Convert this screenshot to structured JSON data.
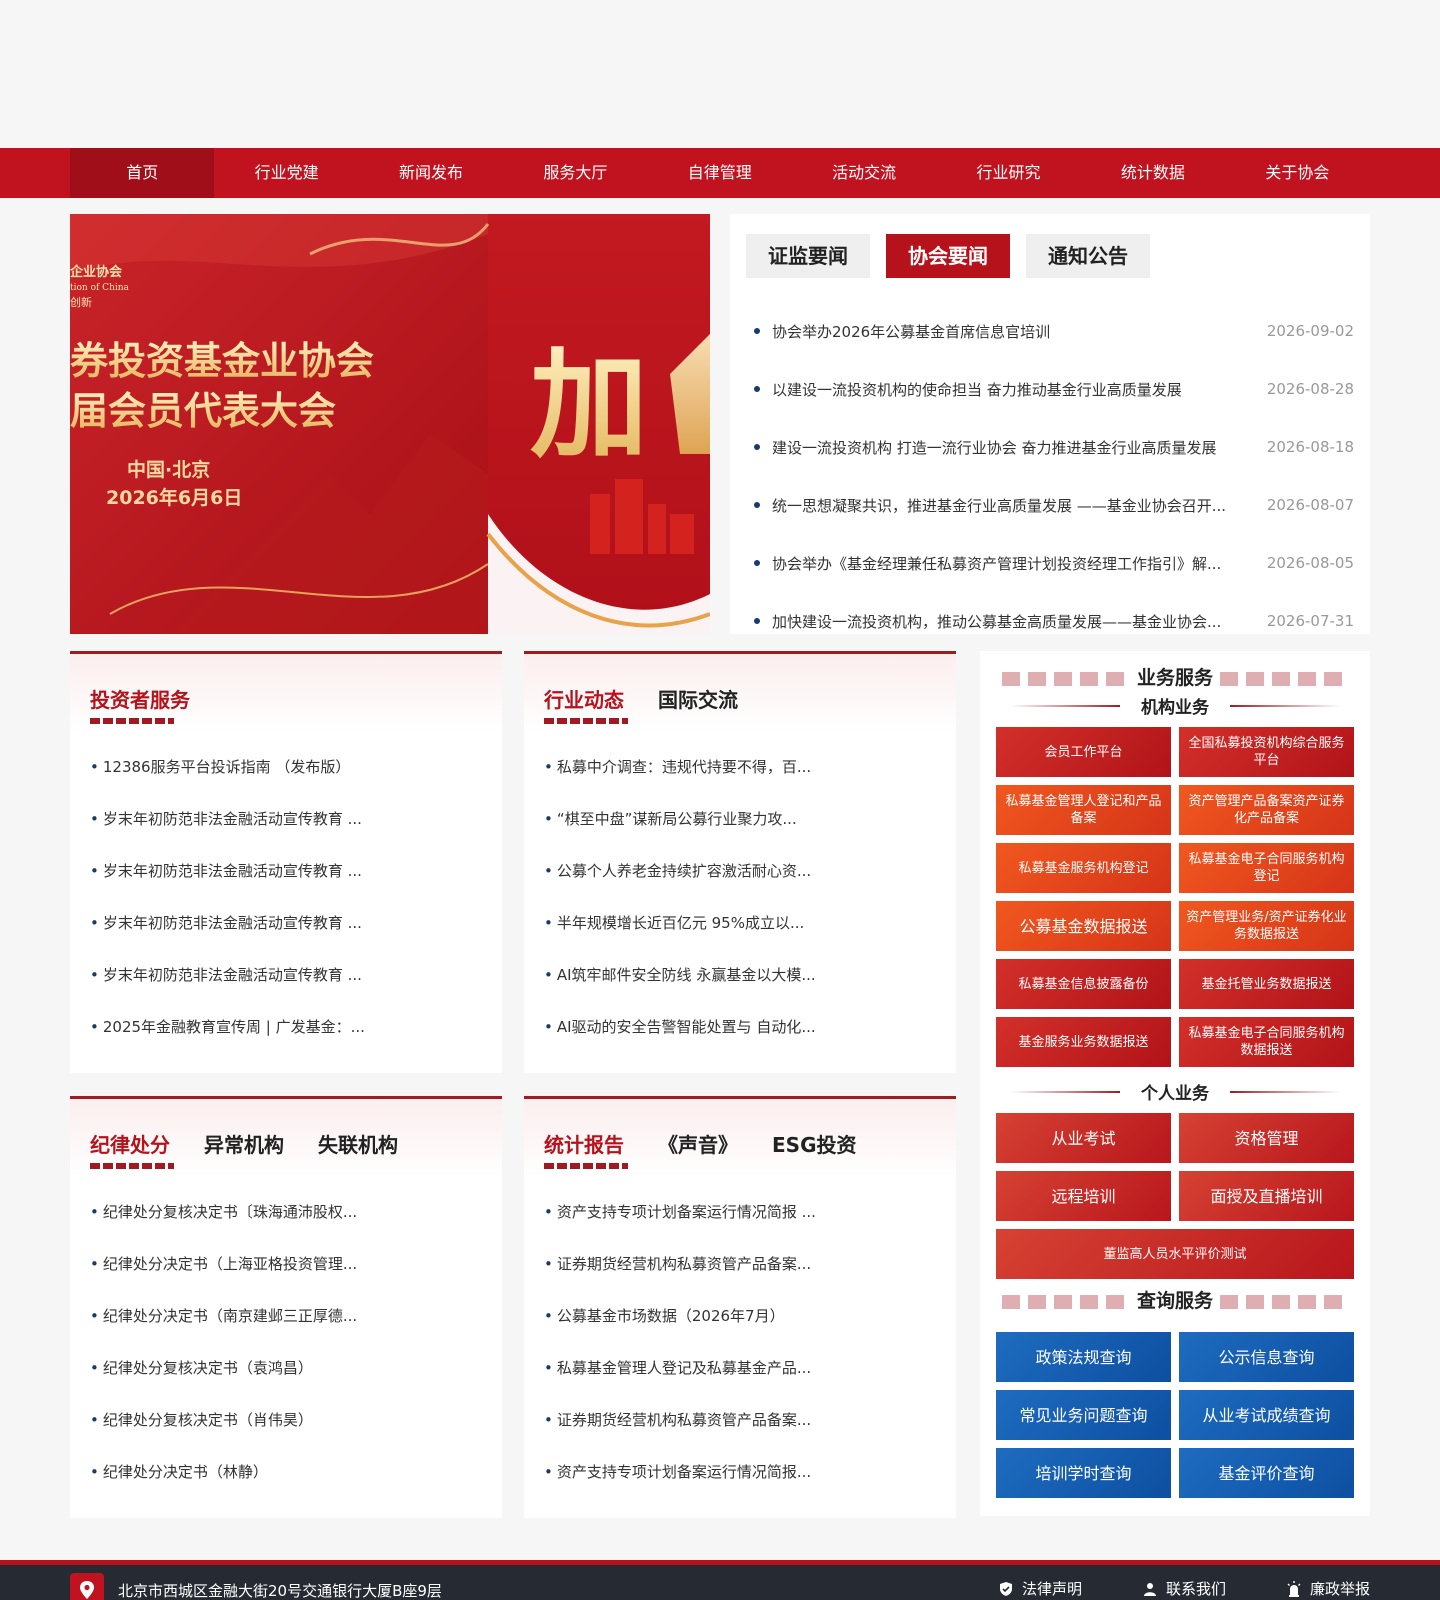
{
  "nav": {
    "items": [
      "首页",
      "行业党建",
      "新闻发布",
      "服务大厅",
      "自律管理",
      "活动交流",
      "行业研究",
      "统计数据",
      "关于协会"
    ]
  },
  "banner": {
    "org_line1": "企业协会",
    "org_line2": "tion of China",
    "org_line3": "创新",
    "title_line1": "券投资基金业协会",
    "title_line2": "届会员代表大会",
    "place": "中国·北京",
    "date": "2026年6月6日",
    "big_text": "加"
  },
  "news": {
    "tabs": [
      "证监要闻",
      "协会要闻",
      "通知公告"
    ],
    "items": [
      {
        "title": "协会举办2026年公募基金首席信息官培训",
        "date": "2026-09-02"
      },
      {
        "title": "以建设一流投资机构的使命担当 奋力推动基金行业高质量发展",
        "date": "2026-08-28"
      },
      {
        "title": "建设一流投资机构 打造一流行业协会 奋力推进基金行业高质量发展",
        "date": "2026-08-18"
      },
      {
        "title": "统一思想凝聚共识，推进基金行业高质量发展 ——基金业协会召开...",
        "date": "2026-08-07"
      },
      {
        "title": "协会举办《基金经理兼任私募资产管理计划投资经理工作指引》解...",
        "date": "2026-08-05"
      },
      {
        "title": "加快建设一流投资机构，推动公募基金高质量发展——基金业协会...",
        "date": "2026-07-31"
      }
    ]
  },
  "investor": {
    "tabs": [
      "投资者服务"
    ],
    "items": [
      "12386服务平台投诉指南 （发布版）",
      "岁末年初防范非法金融活动宣传教育 ...",
      "岁末年初防范非法金融活动宣传教育 ...",
      "岁末年初防范非法金融活动宣传教育 ...",
      "岁末年初防范非法金融活动宣传教育 ...",
      "2025年金融教育宣传周 | 广发基金：..."
    ]
  },
  "industry": {
    "tabs": [
      "行业动态",
      "国际交流"
    ],
    "items": [
      "私募中介调查：违规代持要不得，百...",
      "“棋至中盘”谋新局公募行业聚力攻...",
      "公募个人养老金持续扩容激活耐心资...",
      "半年规模增长近百亿元 95%成立以...",
      "AI筑牢邮件安全防线 永赢基金以大模...",
      "AI驱动的安全告警智能处置与 自动化..."
    ]
  },
  "discipline": {
    "tabs": [
      "纪律处分",
      "异常机构",
      "失联机构"
    ],
    "items": [
      "纪律处分复核决定书〔珠海通沛股权...",
      "纪律处分决定书（上海亚格投资管理...",
      "纪律处分决定书（南京建邺三正厚德...",
      "纪律处分复核决定书（袁鸿昌）",
      "纪律处分复核决定书（肖伟昊）",
      "纪律处分决定书（林静）"
    ]
  },
  "report": {
    "tabs": [
      "统计报告",
      "《声音》",
      "ESG投资"
    ],
    "items": [
      "资产支持专项计划备案运行情况简报 ...",
      "证券期货经营机构私募资管产品备案...",
      "公募基金市场数据（2026年7月）",
      "私募基金管理人登记及私募基金产品...",
      "证券期货经营机构私募资管产品备案...",
      "资产支持专项计划备案运行情况简报..."
    ]
  },
  "services": {
    "title": "业务服务",
    "inst_title": "机构业务",
    "inst": [
      "会员工作平台",
      "全国私募投资机构综合服务平台",
      "私募基金管理人登记和产品备案",
      "资产管理产品备案资产证券化产品备案",
      "私募基金服务机构登记",
      "私募基金电子合同服务机构登记",
      "公募基金数据报送",
      "资产管理业务/资产证券化业务数据报送",
      "私募基金信息披露备份",
      "基金托管业务数据报送",
      "基金服务业务数据报送",
      "私募基金电子合同服务机构数据报送"
    ],
    "personal_title": "个人业务",
    "personal": [
      "从业考试",
      "资格管理",
      "远程培训",
      "面授及直播培训",
      "董监高人员水平评价测试"
    ],
    "query_title": "查询服务",
    "query": [
      "政策法规查询",
      "公示信息查询",
      "常见业务问题查询",
      "从业考试成绩查询",
      "培训学时查询",
      "基金评价查询"
    ]
  },
  "footer": {
    "address": "北京市西城区金融大街20号交通银行大厦B座9层",
    "links": [
      "法律声明",
      "联系我们",
      "廉政举报"
    ]
  }
}
